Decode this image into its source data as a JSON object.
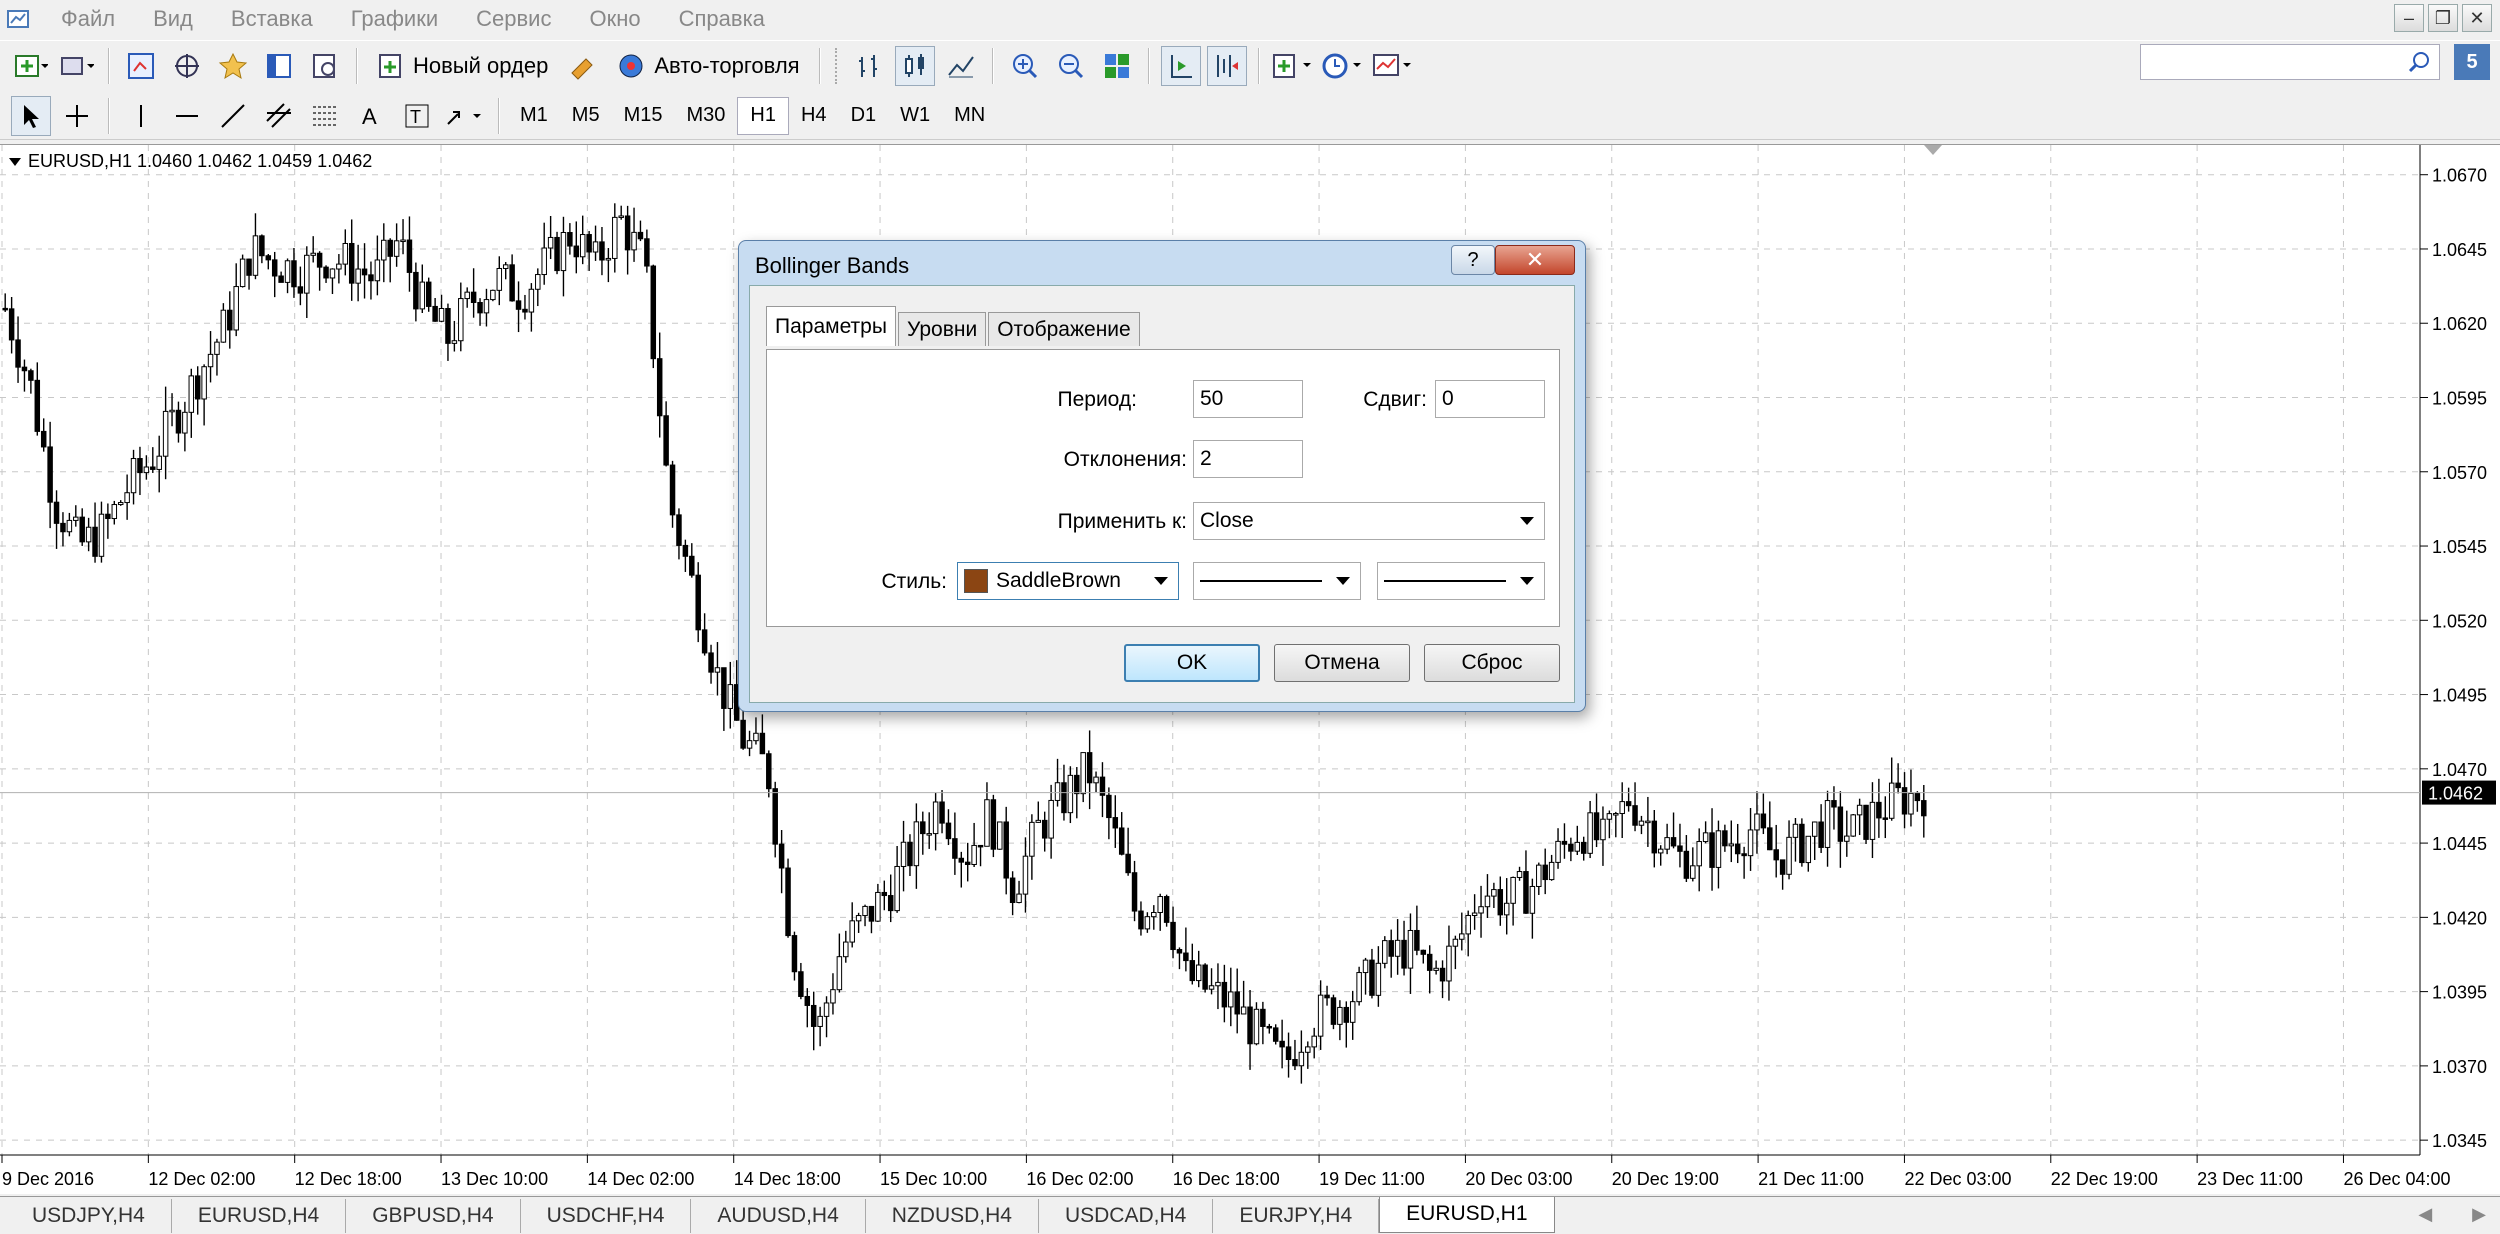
{
  "menu": {
    "items": [
      "Файл",
      "Вид",
      "Вставка",
      "Графики",
      "Сервис",
      "Окно",
      "Справка"
    ]
  },
  "toolbar": {
    "new_order_label": "Новый ордер",
    "auto_trading_label": "Авто-торговля",
    "timeframes": [
      "M1",
      "M5",
      "M15",
      "M30",
      "H1",
      "H4",
      "D1",
      "W1",
      "MN"
    ],
    "active_timeframe": "H1"
  },
  "notifications_count": "5",
  "chart": {
    "title": "EURUSD,H1  1.0460 1.0462 1.0459 1.0462",
    "current_price": "1.0462",
    "accent_color": "#000000",
    "background_color": "#ffffff"
  },
  "chart_data": {
    "type": "candlestick",
    "symbol": "EURUSD",
    "timeframe": "H1",
    "last_ohlc": {
      "open": 1.046,
      "high": 1.0462,
      "low": 1.0459,
      "close": 1.0462
    },
    "y_ticks": [
      "1.0670",
      "1.0645",
      "1.0620",
      "1.0595",
      "1.0570",
      "1.0545",
      "1.0520",
      "1.0495",
      "1.0470",
      "1.0445",
      "1.0420",
      "1.0395",
      "1.0370",
      "1.0345"
    ],
    "ylim": [
      1.034,
      1.068
    ],
    "x_ticks": [
      "9 Dec 2016",
      "12 Dec 02:00",
      "12 Dec 18:00",
      "13 Dec 10:00",
      "14 Dec 02:00",
      "14 Dec 18:00",
      "15 Dec 10:00",
      "16 Dec 02:00",
      "16 Dec 18:00",
      "19 Dec 11:00",
      "20 Dec 03:00",
      "20 Dec 19:00",
      "21 Dec 11:00",
      "22 Dec 03:00",
      "22 Dec 19:00",
      "23 Dec 11:00",
      "26 Dec 04:00"
    ],
    "close_path": [
      1.0625,
      1.06,
      1.056,
      1.0545,
      1.055,
      1.0565,
      1.0575,
      1.059,
      1.0605,
      1.062,
      1.0645,
      1.064,
      1.0638,
      1.0642,
      1.064,
      1.0635,
      1.0648,
      1.0625,
      1.0615,
      1.0628,
      1.0635,
      1.063,
      1.064,
      1.065,
      1.064,
      1.0655,
      1.064,
      1.056,
      1.053,
      1.05,
      1.048,
      1.047,
      1.041,
      1.038,
      1.041,
      1.042,
      1.043,
      1.0445,
      1.046,
      1.044,
      1.0455,
      1.043,
      1.045,
      1.046,
      1.047,
      1.045,
      1.042,
      1.043,
      1.04,
      1.0395,
      1.039,
      1.038,
      1.037,
      1.0385,
      1.039,
      1.0395,
      1.0405,
      1.041,
      1.04,
      1.041,
      1.043,
      1.0425,
      1.043,
      1.044,
      1.045,
      1.0445,
      1.046,
      1.045,
      1.044,
      1.0442,
      1.0445,
      1.045,
      1.044,
      1.0445,
      1.0452,
      1.0448,
      1.0455,
      1.046,
      1.0462
    ],
    "grid": true,
    "grid_style": "dashed"
  },
  "dialog": {
    "title": "Bollinger Bands",
    "help_label": "?",
    "close_label": "✕",
    "tabs": [
      "Параметры",
      "Уровни",
      "Отображение"
    ],
    "active_tab": "Параметры",
    "period_label": "Период:",
    "period_value": "50",
    "shift_label": "Сдвиг:",
    "shift_value": "0",
    "deviations_label": "Отклонения:",
    "deviations_value": "2",
    "apply_to_label": "Применить к:",
    "apply_to_value": "Close",
    "style_label": "Стиль:",
    "style_color_name": "SaddleBrown",
    "style_color": "#8b4513",
    "ok_label": "OK",
    "cancel_label": "Отмена",
    "reset_label": "Сброс"
  },
  "bottom_tabs": [
    "USDJPY,H4",
    "EURUSD,H4",
    "GBPUSD,H4",
    "USDCHF,H4",
    "AUDUSD,H4",
    "NZDUSD,H4",
    "USDCAD,H4",
    "EURJPY,H4",
    "EURUSD,H1"
  ],
  "active_bottom_tab": "EURUSD,H1"
}
